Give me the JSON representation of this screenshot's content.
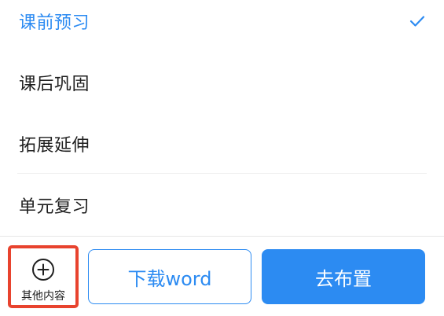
{
  "menu": {
    "items": [
      {
        "label": "课前预习",
        "selected": true
      },
      {
        "label": "课后巩固",
        "selected": false
      },
      {
        "label": "拓展延伸",
        "selected": false
      },
      {
        "label": "单元复习",
        "selected": false
      }
    ],
    "selected_icon": "checkmark-icon"
  },
  "footer": {
    "more_label": "其他内容",
    "more_icon": "plus-circle-icon",
    "download_label": "下载word",
    "assign_label": "去布置"
  },
  "colors": {
    "accent": "#2c8bf2",
    "highlight_border": "#e8432e",
    "text": "#1f1f1f"
  }
}
